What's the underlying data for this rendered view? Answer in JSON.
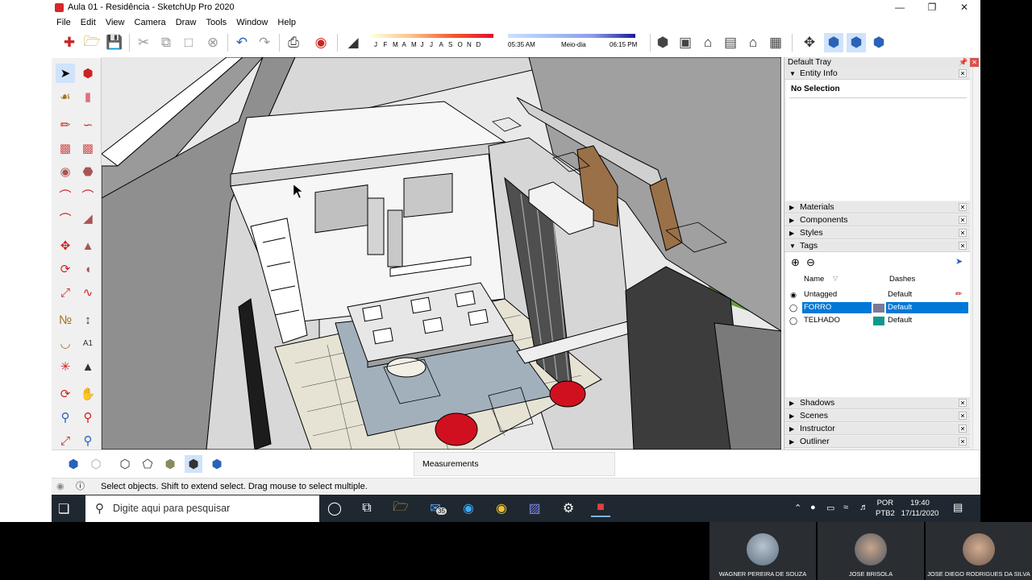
{
  "window": {
    "title": "Aula 01 - Residência - SketchUp Pro 2020",
    "app_icon": "sketchup-icon",
    "controls": [
      "minimize-icon",
      "restore-icon",
      "close-icon"
    ]
  },
  "menu": [
    "File",
    "Edit",
    "View",
    "Camera",
    "Draw",
    "Tools",
    "Window",
    "Help"
  ],
  "shadow_settings": {
    "months": [
      "J",
      "F",
      "M",
      "A",
      "M",
      "J",
      "J",
      "A",
      "S",
      "O",
      "N",
      "D"
    ],
    "time_start": "05:35 AM",
    "time_mid": "Meio-dia",
    "time_end": "06:15 PM"
  },
  "tray": {
    "title": "Default Tray",
    "entity_info": {
      "label": "Entity Info",
      "selection": "No Selection"
    },
    "panels_top": [
      "Materials",
      "Components",
      "Styles",
      "Tags"
    ],
    "panels_bottom": [
      "Shadows",
      "Scenes",
      "Instructor",
      "Outliner"
    ],
    "tags": {
      "col_name": "Name",
      "col_dashes": "Dashes",
      "rows": [
        {
          "name": "Untagged",
          "dash": "Default",
          "color": "#ffffff",
          "selected": false
        },
        {
          "name": "FORRO",
          "dash": "Default",
          "color": "#7a7a96",
          "selected": true
        },
        {
          "name": "TELHADO",
          "dash": "Default",
          "color": "#10988a",
          "selected": false
        }
      ]
    }
  },
  "measurements": {
    "label": "Measurements"
  },
  "status": {
    "text": "Select objects. Shift to extend select. Drag mouse to select multiple."
  },
  "taskbar": {
    "search_placeholder": "Digite aqui para pesquisar",
    "mail_badge": "35",
    "lang_1": "POR",
    "lang_2": "PTB2",
    "time": "19:40",
    "date": "17/11/2020"
  },
  "participants": [
    {
      "name": "WAGNER PEREIRA DE SOUZA"
    },
    {
      "name": "JOSE BRISOLA"
    },
    {
      "name": "JOSE DIEGO RODRIGUES DA SILVA"
    }
  ],
  "colors": {
    "accent": "#0078d7",
    "sketchup_red": "#d8262c",
    "taskbar": "#1f2830"
  }
}
